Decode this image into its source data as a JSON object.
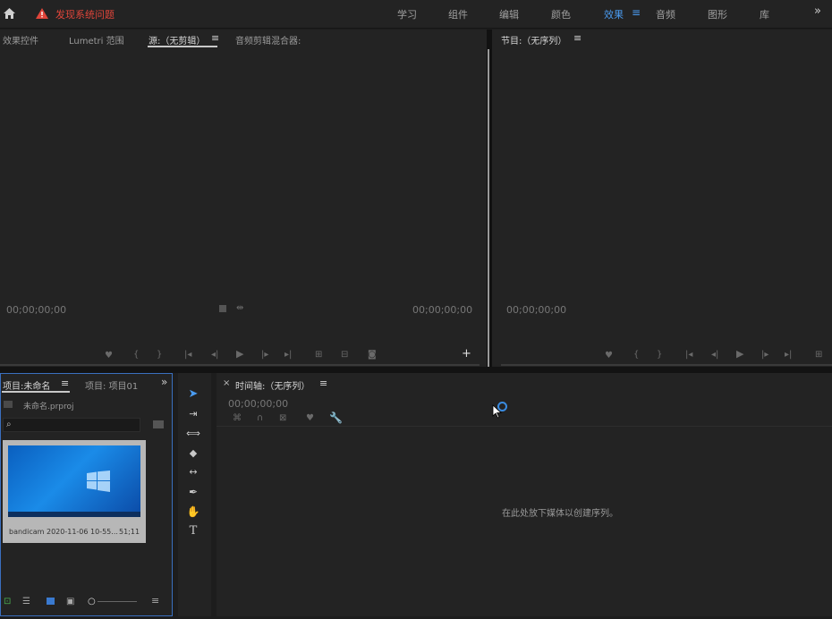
{
  "topbar": {
    "alert_text": "发现系统问题",
    "workspaces": [
      "学习",
      "组件",
      "编辑",
      "颜色",
      "效果",
      "音频",
      "图形",
      "库"
    ],
    "active_workspace": "效果",
    "more_glyph": "»"
  },
  "source_panel": {
    "tabs": [
      "效果控件",
      "Lumetri 范围",
      "源:（无剪辑）",
      "音频剪辑混合器:"
    ],
    "active_tab_index": 2,
    "timecode_left": "00;00;00;00",
    "timecode_right": "00;00;00;00"
  },
  "program_panel": {
    "tab": "节目:（无序列）",
    "timecode_left": "00;00;00;00"
  },
  "project_panel": {
    "tabs": [
      "项目:未命名",
      "项目: 项目01"
    ],
    "project_file": "未命名.prproj",
    "search_placeholder": "",
    "clip_name": "bandicam 2020-11-06 10-55...",
    "clip_duration": "51;11"
  },
  "timeline_panel": {
    "tab": "时间轴:（无序列）",
    "timecode": "00;00;00;00",
    "drop_hint": "在此处放下媒体以创建序列。"
  },
  "icons": {
    "home": "home-icon",
    "warning": "warning-icon",
    "menu": "hamburger-menu-icon"
  },
  "colors": {
    "accent": "#4a9bf0",
    "alert": "#e0453a",
    "panel_bg": "#232323",
    "app_bg": "#1d1d1d"
  }
}
